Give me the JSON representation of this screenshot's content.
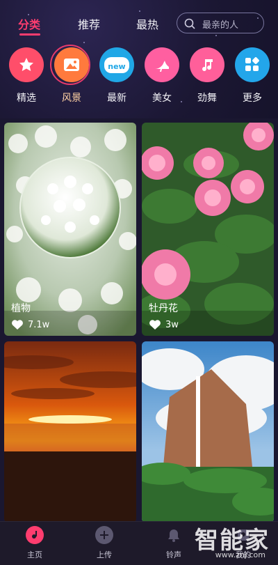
{
  "topnav": {
    "tabs": [
      {
        "label": "分类",
        "active": true
      },
      {
        "label": "推荐",
        "active": false
      },
      {
        "label": "最热",
        "active": false
      }
    ],
    "search_placeholder": "最亲的人"
  },
  "categories": [
    {
      "label": "精选",
      "icon": "star-icon",
      "color": "#ff4e6a"
    },
    {
      "label": "风景",
      "icon": "landscape-icon",
      "color": "#ff7a3d",
      "active": true
    },
    {
      "label": "最新",
      "icon": "new-badge-icon",
      "color": "#20a7e6",
      "badge": "new"
    },
    {
      "label": "美女",
      "icon": "high-heel-icon",
      "color": "#ff5fa0"
    },
    {
      "label": "劲舞",
      "icon": "music-note-icon",
      "color": "#ff5f9a"
    },
    {
      "label": "更多",
      "icon": "grid-more-icon",
      "color": "#23a6ea"
    }
  ],
  "cards": [
    {
      "title": "植物",
      "likes": "7.1w"
    },
    {
      "title": "牡丹花",
      "likes": "3w"
    },
    {
      "title": "",
      "likes": ""
    },
    {
      "title": "",
      "likes": ""
    }
  ],
  "tabbar": {
    "items": [
      {
        "label": "主页",
        "icon": "music-disc-icon",
        "active": true
      },
      {
        "label": "上传",
        "icon": "plus-circle-icon"
      },
      {
        "label": "铃声",
        "icon": "bell-icon"
      },
      {
        "label": "我的",
        "icon": "profile-icon"
      }
    ]
  },
  "watermark": {
    "text": "智能家",
    "sub": "www.znj.com"
  }
}
